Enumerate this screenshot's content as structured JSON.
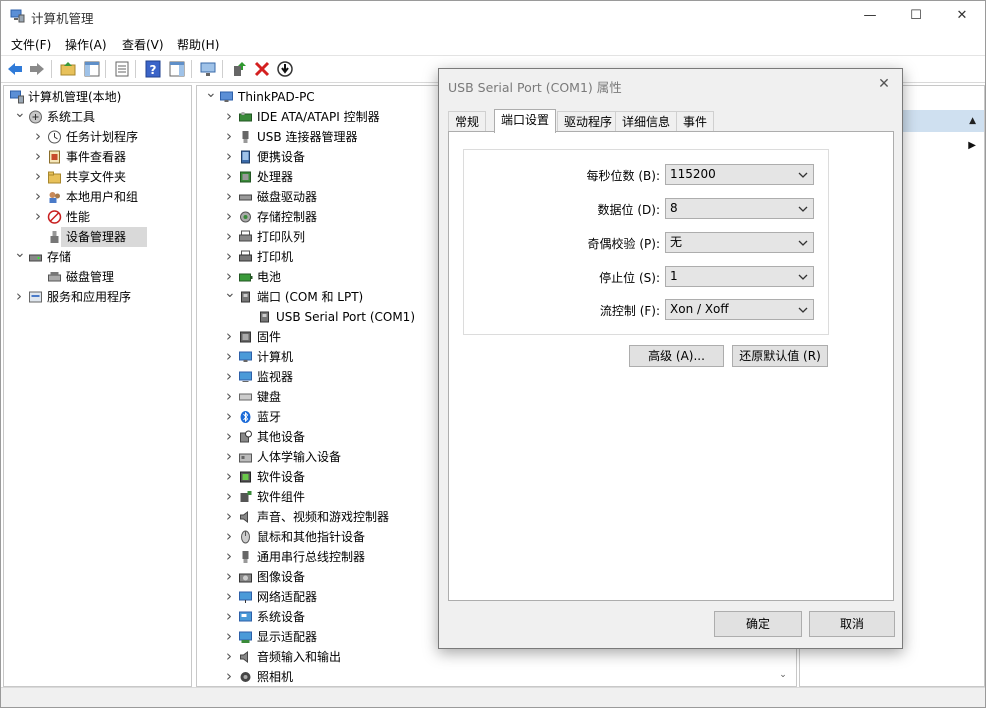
{
  "window": {
    "title": "计算机管理",
    "minimize": "—",
    "maximize": "☐",
    "close": "✕"
  },
  "menu": [
    "文件(F)",
    "操作(A)",
    "查看(V)",
    "帮助(H)"
  ],
  "left_tree": [
    {
      "label": "计算机管理(本地)",
      "indent": 0,
      "icon": "computer-management-icon",
      "chev": ""
    },
    {
      "label": "系统工具",
      "indent": 1,
      "icon": "system-tools-icon",
      "chev": "v"
    },
    {
      "label": "任务计划程序",
      "indent": 2,
      "icon": "task-scheduler-icon",
      "chev": ">"
    },
    {
      "label": "事件查看器",
      "indent": 2,
      "icon": "event-viewer-icon",
      "chev": ">"
    },
    {
      "label": "共享文件夹",
      "indent": 2,
      "icon": "shared-folders-icon",
      "chev": ">"
    },
    {
      "label": "本地用户和组",
      "indent": 2,
      "icon": "local-users-icon",
      "chev": ">"
    },
    {
      "label": "性能",
      "indent": 2,
      "icon": "performance-icon",
      "chev": ">"
    },
    {
      "label": "设备管理器",
      "indent": 2,
      "icon": "device-manager-icon",
      "chev": "",
      "selected": true
    },
    {
      "label": "存储",
      "indent": 1,
      "icon": "storage-icon",
      "chev": "v"
    },
    {
      "label": "磁盘管理",
      "indent": 2,
      "icon": "disk-management-icon",
      "chev": ""
    },
    {
      "label": "服务和应用程序",
      "indent": 1,
      "icon": "services-apps-icon",
      "chev": ">"
    }
  ],
  "device_tree": [
    {
      "label": "ThinkPAD-PC",
      "indent": 0,
      "chev": "v",
      "icon": "computer-icon"
    },
    {
      "label": "IDE ATA/ATAPI 控制器",
      "indent": 1,
      "chev": ">",
      "icon": "ide-controller-icon"
    },
    {
      "label": "USB 连接器管理器",
      "indent": 1,
      "chev": ">",
      "icon": "usb-connector-icon"
    },
    {
      "label": "便携设备",
      "indent": 1,
      "chev": ">",
      "icon": "portable-device-icon"
    },
    {
      "label": "处理器",
      "indent": 1,
      "chev": ">",
      "icon": "processor-icon"
    },
    {
      "label": "磁盘驱动器",
      "indent": 1,
      "chev": ">",
      "icon": "disk-drive-icon"
    },
    {
      "label": "存储控制器",
      "indent": 1,
      "chev": ">",
      "icon": "storage-controller-icon"
    },
    {
      "label": "打印队列",
      "indent": 1,
      "chev": ">",
      "icon": "print-queue-icon"
    },
    {
      "label": "打印机",
      "indent": 1,
      "chev": ">",
      "icon": "printer-icon"
    },
    {
      "label": "电池",
      "indent": 1,
      "chev": ">",
      "icon": "battery-icon"
    },
    {
      "label": "端口 (COM 和 LPT)",
      "indent": 1,
      "chev": "v",
      "icon": "port-icon"
    },
    {
      "label": "USB Serial Port (COM1)",
      "indent": 2,
      "chev": "",
      "icon": "serial-port-icon"
    },
    {
      "label": "固件",
      "indent": 1,
      "chev": ">",
      "icon": "firmware-icon"
    },
    {
      "label": "计算机",
      "indent": 1,
      "chev": ">",
      "icon": "computer-monitor-icon"
    },
    {
      "label": "监视器",
      "indent": 1,
      "chev": ">",
      "icon": "monitor-icon"
    },
    {
      "label": "键盘",
      "indent": 1,
      "chev": ">",
      "icon": "keyboard-icon"
    },
    {
      "label": "蓝牙",
      "indent": 1,
      "chev": ">",
      "icon": "bluetooth-icon"
    },
    {
      "label": "其他设备",
      "indent": 1,
      "chev": ">",
      "icon": "other-devices-icon"
    },
    {
      "label": "人体学输入设备",
      "indent": 1,
      "chev": ">",
      "icon": "hid-icon"
    },
    {
      "label": "软件设备",
      "indent": 1,
      "chev": ">",
      "icon": "software-device-icon"
    },
    {
      "label": "软件组件",
      "indent": 1,
      "chev": ">",
      "icon": "software-component-icon"
    },
    {
      "label": "声音、视频和游戏控制器",
      "indent": 1,
      "chev": ">",
      "icon": "sound-icon"
    },
    {
      "label": "鼠标和其他指针设备",
      "indent": 1,
      "chev": ">",
      "icon": "mouse-icon"
    },
    {
      "label": "通用串行总线控制器",
      "indent": 1,
      "chev": ">",
      "icon": "usb-controller-icon"
    },
    {
      "label": "图像设备",
      "indent": 1,
      "chev": ">",
      "icon": "imaging-device-icon"
    },
    {
      "label": "网络适配器",
      "indent": 1,
      "chev": ">",
      "icon": "network-adapter-icon"
    },
    {
      "label": "系统设备",
      "indent": 1,
      "chev": ">",
      "icon": "system-device-icon"
    },
    {
      "label": "显示适配器",
      "indent": 1,
      "chev": ">",
      "icon": "display-adapter-icon"
    },
    {
      "label": "音频输入和输出",
      "indent": 1,
      "chev": ">",
      "icon": "audio-io-icon"
    },
    {
      "label": "照相机",
      "indent": 1,
      "chev": ">",
      "icon": "camera-icon"
    }
  ],
  "dialog": {
    "title": "USB Serial Port (COM1) 属性",
    "close": "✕",
    "tabs": [
      "常规",
      "端口设置",
      "驱动程序",
      "详细信息",
      "事件"
    ],
    "active_tab": 1,
    "fields": [
      {
        "label": "每秒位数 (B):",
        "value": "115200"
      },
      {
        "label": "数据位 (D):",
        "value": "8"
      },
      {
        "label": "奇偶校验 (P):",
        "value": "无"
      },
      {
        "label": "停止位 (S):",
        "value": "1"
      },
      {
        "label": "流控制 (F):",
        "value": "Xon / Xoff"
      }
    ],
    "advanced_button": "高级 (A)...",
    "restore_button": "还原默认值 (R)",
    "ok_button": "确定",
    "cancel_button": "取消"
  },
  "colors": {
    "selection": "#d9d9d9",
    "right_header": "#cfe0f0",
    "dialog_bg": "#f0f0f0"
  }
}
